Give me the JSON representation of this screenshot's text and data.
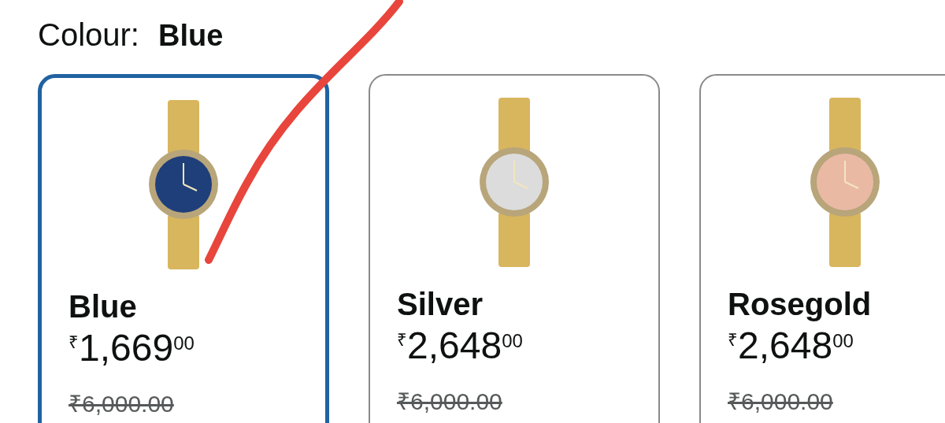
{
  "colour": {
    "label": "Colour:",
    "value": "Blue"
  },
  "variants": [
    {
      "name": "Blue",
      "currency": "₹",
      "price_whole": "1,669",
      "price_fraction": "00",
      "list_price": "₹6,000.00",
      "selected": true,
      "color": "#1f3f7a"
    },
    {
      "name": "Silver",
      "currency": "₹",
      "price_whole": "2,648",
      "price_fraction": "00",
      "list_price": "₹6,000.00",
      "selected": false,
      "color": "#dcdcdc"
    },
    {
      "name": "Rosegold",
      "currency": "₹",
      "price_whole": "2,648",
      "price_fraction": "00",
      "list_price": "₹6,000.00",
      "selected": false,
      "color": "#eab9a4"
    }
  ]
}
